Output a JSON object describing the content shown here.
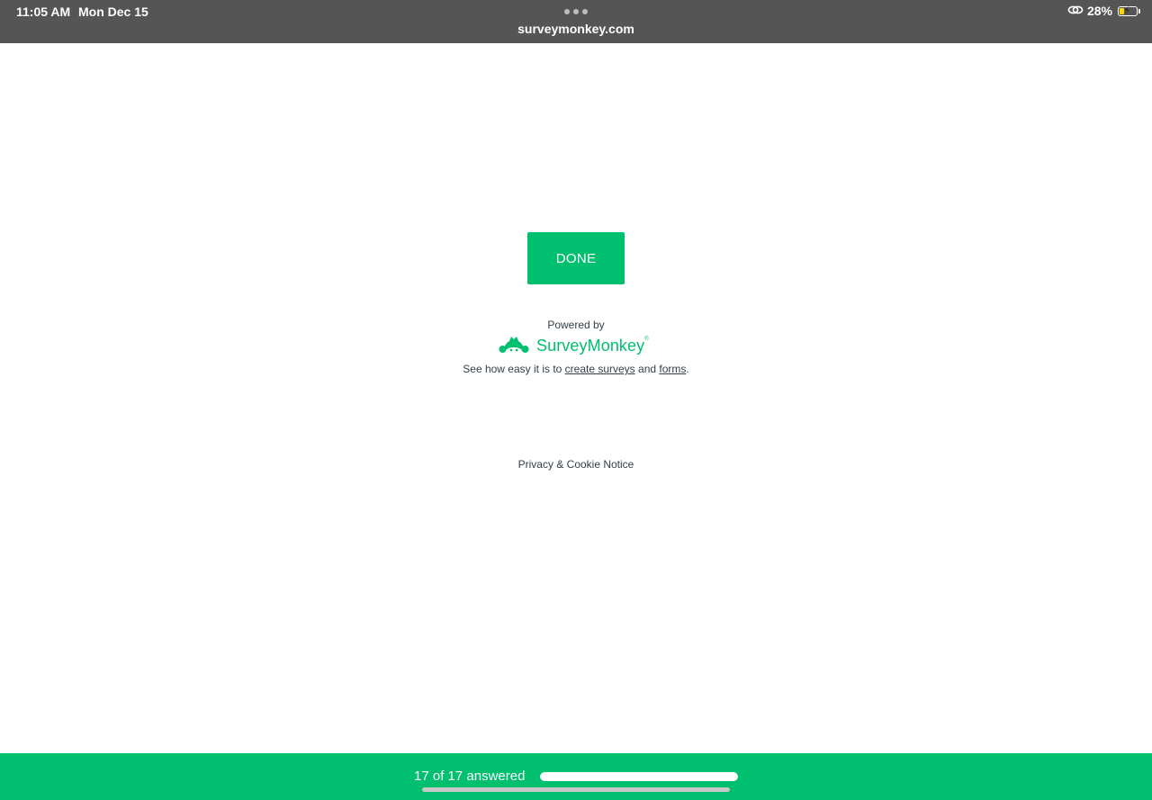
{
  "status_bar": {
    "time": "11:05 AM",
    "date": "Mon Dec 15",
    "url": "surveymonkey.com",
    "battery_percent": "28%",
    "battery_level": 0.28,
    "icons": [
      "more-dots-icon",
      "link-icon",
      "battery-icon"
    ]
  },
  "main": {
    "done_label": "DONE",
    "powered_by": "Powered by",
    "brand_name": "SurveyMonkey",
    "brand_mark": "®",
    "promo_prefix": "See how easy it is to ",
    "promo_link_1": "create surveys",
    "promo_middle": " and ",
    "promo_link_2": "forms",
    "promo_suffix": ".",
    "privacy_link": "Privacy & Cookie Notice"
  },
  "footer": {
    "progress_text": "17 of 17 answered",
    "progress_fraction": 1.0
  },
  "colors": {
    "brand_green": "#00bf6f",
    "status_bar_bg": "#555555",
    "text": "#333e48"
  }
}
